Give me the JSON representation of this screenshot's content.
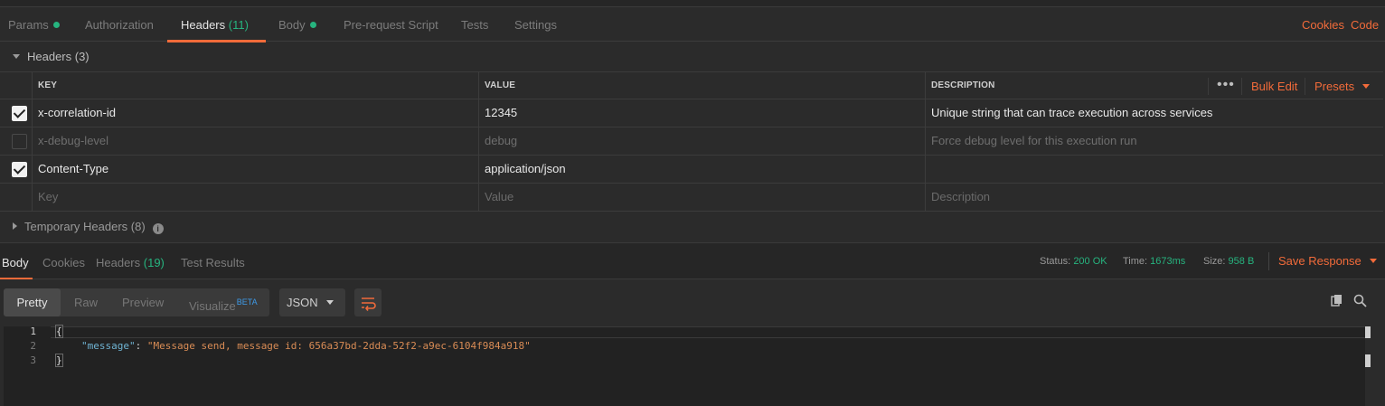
{
  "request_tabs": {
    "params": "Params",
    "authorization": "Authorization",
    "headers": "Headers",
    "headers_count": "(11)",
    "body": "Body",
    "prerequest": "Pre-request Script",
    "tests": "Tests",
    "settings": "Settings",
    "cookies": "Cookies",
    "code": "Code"
  },
  "headers_section": {
    "title": "Headers (3)",
    "columns": {
      "key": "KEY",
      "value": "VALUE",
      "description": "DESCRIPTION"
    },
    "more": "•••",
    "bulk_edit": "Bulk Edit",
    "presets": "Presets",
    "rows": [
      {
        "checked": true,
        "key": "x-correlation-id",
        "value": "12345",
        "description": "Unique string that can trace execution across services"
      },
      {
        "checked": false,
        "key": "x-debug-level",
        "value": "debug",
        "description": "Force debug level for this execution run"
      },
      {
        "checked": true,
        "key": "Content-Type",
        "value": "application/json",
        "description": ""
      }
    ],
    "placeholders": {
      "key": "Key",
      "value": "Value",
      "description": "Description"
    },
    "temporary": "Temporary Headers (8)"
  },
  "response": {
    "tabs": {
      "body": "Body",
      "cookies": "Cookies",
      "headers": "Headers",
      "headers_count": "(19)",
      "test_results": "Test Results"
    },
    "status_label": "Status:",
    "status_value": "200 OK",
    "time_label": "Time:",
    "time_value": "1673ms",
    "size_label": "Size:",
    "size_value": "958 B",
    "save_response": "Save Response",
    "views": {
      "pretty": "Pretty",
      "raw": "Raw",
      "preview": "Preview",
      "visualize": "Visualize",
      "beta": "BETA"
    },
    "format": "JSON",
    "code": {
      "line_numbers": [
        "1",
        "2",
        "3"
      ],
      "open_brace": "{",
      "key": "\"message\"",
      "colon": ": ",
      "value": "\"Message send, message id: 656a37bd-2dda-52f2-a9ec-6104f984a918\"",
      "close_brace": "}"
    }
  },
  "colors": {
    "accent": "#f26b3a",
    "success": "#26b47f",
    "beta": "#3d9ae8"
  }
}
